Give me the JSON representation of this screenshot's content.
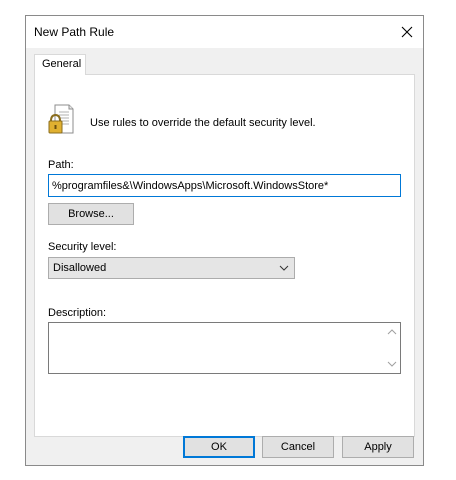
{
  "window": {
    "title": "New Path Rule",
    "close_icon": "close-icon"
  },
  "tabs": [
    {
      "label": "General",
      "selected": true
    }
  ],
  "info": {
    "icon": "document-lock-icon",
    "text": "Use rules to override the default security level."
  },
  "path": {
    "label": "Path:",
    "value": "%programfiles&\\WindowsApps\\Microsoft.WindowsStore*",
    "browse_label": "Browse..."
  },
  "security": {
    "label": "Security level:",
    "selected": "Disallowed"
  },
  "description": {
    "label": "Description:",
    "value": ""
  },
  "footer": {
    "ok_label": "OK",
    "cancel_label": "Cancel",
    "apply_label": "Apply"
  },
  "colors": {
    "focus_accent": "#0078d7",
    "dialog_bg": "#f0f0f0"
  }
}
